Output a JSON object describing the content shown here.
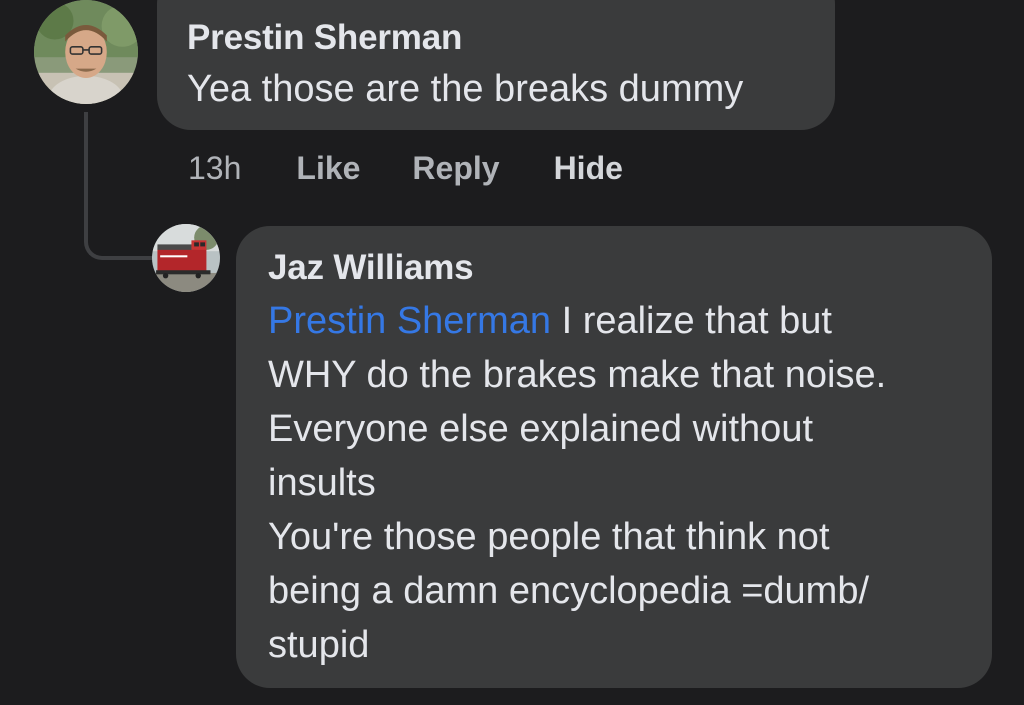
{
  "comments": [
    {
      "author": "Prestin Sherman",
      "text": "Yea those are the breaks dummy",
      "time": "13h",
      "actions": {
        "like": "Like",
        "reply": "Reply",
        "hide": "Hide"
      },
      "avatar": "person-photo-avatar"
    },
    {
      "author": "Jaz Williams",
      "mention": "Prestin Sherman",
      "lines": [
        " I realize that but",
        "WHY do the brakes make that noise.",
        "Everyone else explained without",
        "insults",
        "You're those people that think not",
        "being a damn encyclopedia =dumb/",
        "stupid"
      ],
      "avatar": "train-photo-avatar"
    }
  ],
  "colors": {
    "background": "#1c1c1e",
    "bubble": "#3a3b3c",
    "text": "#e4e6eb",
    "secondary_text": "#b0b3b8",
    "mention": "#3578e5"
  }
}
